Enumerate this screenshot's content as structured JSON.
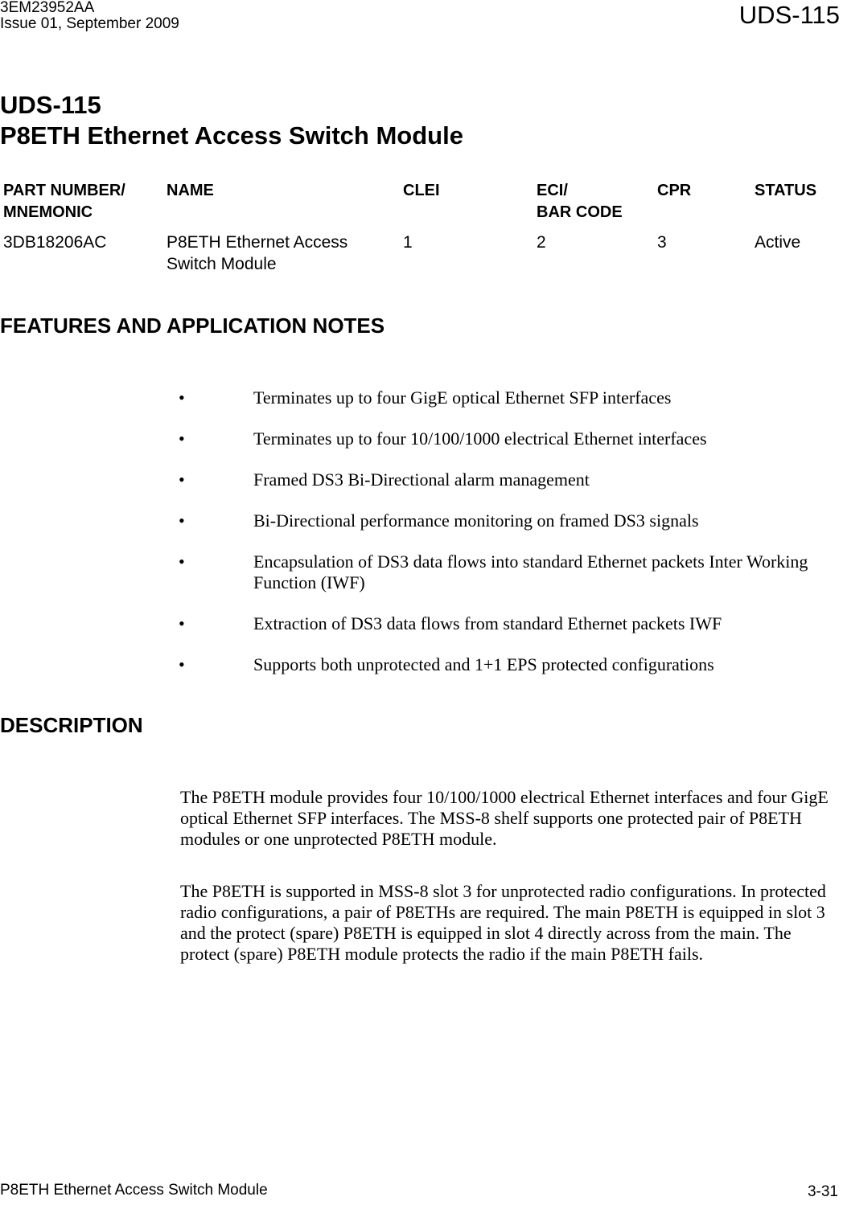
{
  "header": {
    "doc_number": "3EM23952AA",
    "issue": "Issue 01, September 2009",
    "doc_code": "UDS-115"
  },
  "title": {
    "line1": "UDS-115",
    "line2": "P8ETH Ethernet Access Switch Module"
  },
  "spec_table": {
    "headers": [
      {
        "line1": "PART NUMBER/",
        "line2": "MNEMONIC"
      },
      {
        "line1": "NAME",
        "line2": ""
      },
      {
        "line1": "CLEI",
        "line2": ""
      },
      {
        "line1": "ECI/",
        "line2": "BAR CODE"
      },
      {
        "line1": "CPR",
        "line2": ""
      },
      {
        "line1": "STATUS",
        "line2": ""
      }
    ],
    "rows": [
      {
        "part_number": "3DB18206AC",
        "name_line1": "P8ETH Ethernet Access",
        "name_line2": "Switch Module",
        "clei": "1",
        "eci": "2",
        "cpr": "3",
        "status": "Active"
      }
    ]
  },
  "features": {
    "heading": "FEATURES AND APPLICATION NOTES",
    "bullet_glyph": "•",
    "items": [
      "Terminates up to four GigE optical Ethernet SFP interfaces",
      "Terminates up to four 10/100/1000 electrical Ethernet interfaces",
      "Framed DS3 Bi-Directional alarm management",
      "Bi-Directional performance monitoring on framed DS3 signals",
      "Encapsulation of DS3 data flows into standard Ethernet packets Inter Working Function (IWF)",
      "Extraction of DS3 data flows from standard Ethernet packets IWF",
      "Supports both unprotected and 1+1 EPS protected configurations"
    ]
  },
  "description": {
    "heading": "DESCRIPTION",
    "paragraphs": [
      "The P8ETH module provides four 10/100/1000 electrical Ethernet interfaces and four GigE optical Ethernet SFP interfaces. The MSS-8 shelf supports one protected pair of P8ETH modules or one unprotected P8ETH module.",
      "The P8ETH is supported in MSS-8 slot 3 for unprotected radio configurations. In protected radio configurations, a pair of P8ETHs are required. The main P8ETH is equipped in slot 3 and the protect (spare) P8ETH is equipped in slot 4 directly across from the main. The protect (spare) P8ETH module protects the radio if the main P8ETH fails."
    ]
  },
  "footer": {
    "module_name": "P8ETH Ethernet Access Switch Module",
    "page_number": "3-31"
  }
}
